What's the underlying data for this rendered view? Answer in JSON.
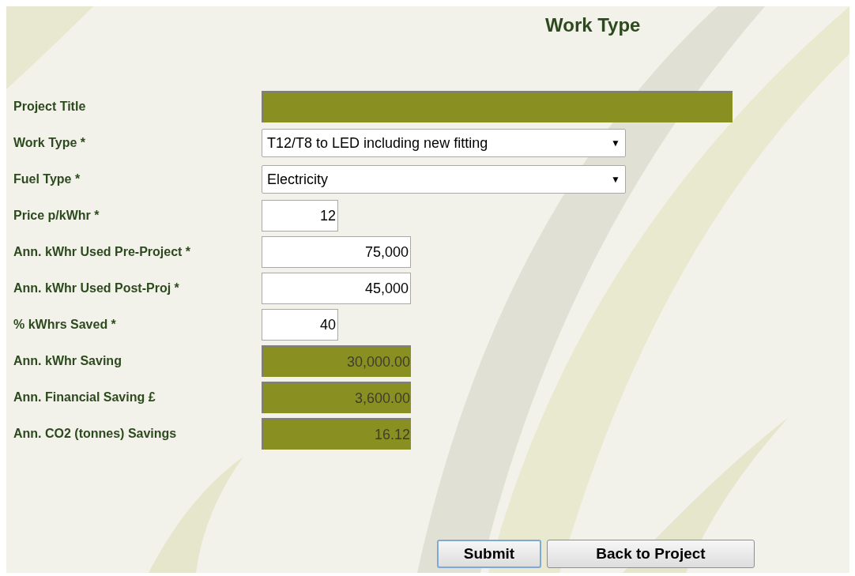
{
  "title": "Work Type",
  "fields": [
    {
      "label": "Project Title",
      "kind": "bar"
    },
    {
      "label": "Work Type *",
      "kind": "select",
      "value": "T12/T8 to LED including new fitting",
      "arrow": "▼"
    },
    {
      "label": "Fuel Type *",
      "kind": "select",
      "value": "Electricity",
      "arrow": "▼"
    },
    {
      "label": "Price p/kWhr *",
      "kind": "short",
      "value": "12"
    },
    {
      "label": "Ann. kWhr Used Pre-Project *",
      "kind": "long",
      "value": "75,000"
    },
    {
      "label": "Ann. kWhr Used Post-Proj *",
      "kind": "long",
      "value": "45,000"
    },
    {
      "label": "% kWhrs Saved *",
      "kind": "short",
      "value": "40"
    },
    {
      "label": "Ann. kWhr Saving",
      "kind": "result",
      "value": "30,000.00"
    },
    {
      "label": "Ann. Financial Saving £",
      "kind": "result",
      "value": "3,600.00"
    },
    {
      "label": "Ann. CO2 (tonnes) Savings",
      "kind": "result",
      "value": "16.12"
    }
  ],
  "buttons": [
    {
      "label": "Submit",
      "focused": true
    },
    {
      "label": "Back to Project",
      "focused": false
    }
  ]
}
